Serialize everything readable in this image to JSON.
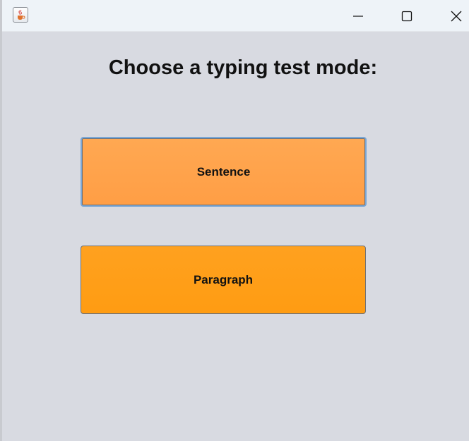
{
  "window": {
    "app_icon": "java-cup-icon",
    "controls": {
      "minimize_icon": "minimize-icon",
      "maximize_icon": "maximize-icon",
      "close_icon": "close-icon"
    }
  },
  "main": {
    "heading": "Choose a typing test mode:",
    "buttons": [
      {
        "label": "Sentence",
        "color": "#ffa54d",
        "focused": true
      },
      {
        "label": "Paragraph",
        "color": "#ffa01a",
        "focused": false
      }
    ]
  }
}
